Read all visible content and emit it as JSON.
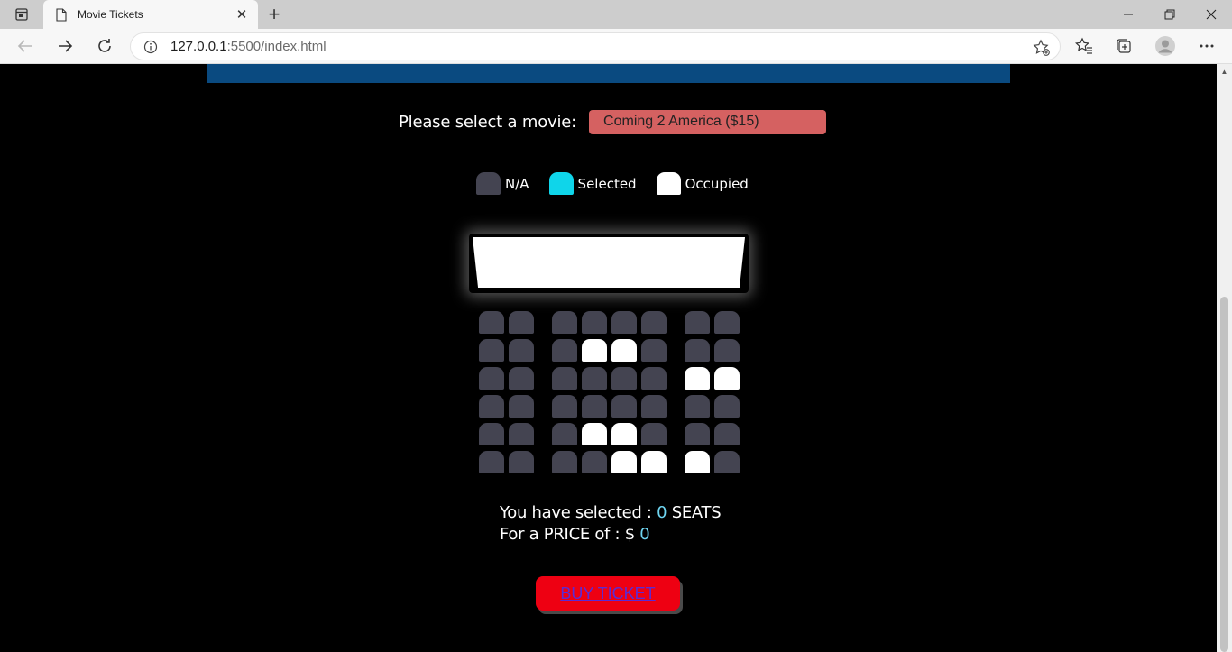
{
  "browser": {
    "tab_title": "Movie Tickets",
    "address_host": "127.0.0.1",
    "address_rest": ":5500/index.html",
    "new_tab_symbol": "+",
    "close_tab_symbol": "✕",
    "window_controls": [
      "minimize",
      "restore",
      "close"
    ]
  },
  "page": {
    "movie_label": "Please select a movie:",
    "movie_selected": "Coming 2 America ($15)",
    "legend": [
      {
        "label": "N/A",
        "status": "available",
        "color": "#444451"
      },
      {
        "label": "Selected",
        "status": "selected",
        "color": "#0fd5ea"
      },
      {
        "label": "Occupied",
        "status": "occupied",
        "color": "#ffffff"
      }
    ],
    "seat_rows": [
      [
        "n",
        "n",
        "n",
        "n",
        "n",
        "n",
        "n",
        "n"
      ],
      [
        "n",
        "n",
        "n",
        "o",
        "o",
        "n",
        "n",
        "n"
      ],
      [
        "n",
        "n",
        "n",
        "n",
        "n",
        "n",
        "o",
        "o"
      ],
      [
        "n",
        "n",
        "n",
        "n",
        "n",
        "n",
        "n",
        "n"
      ],
      [
        "n",
        "n",
        "n",
        "o",
        "o",
        "n",
        "n",
        "n"
      ],
      [
        "n",
        "n",
        "n",
        "n",
        "o",
        "o",
        "o",
        "n"
      ]
    ],
    "summary_line1_prefix": "You have selected :",
    "selected_count": "0",
    "summary_line1_suffix": "SEATS",
    "summary_line2_prefix": "For a PRICE of : $",
    "total_price": "0",
    "buy_button": "BUY TICKET"
  },
  "colors": {
    "banner": "#0a4a80",
    "select_bg": "#d56161",
    "seat_na": "#444451",
    "seat_selected": "#0fd5ea",
    "seat_occupied": "#ffffff",
    "buy_button": "#ee0012",
    "number_accent": "#6fd6f2"
  }
}
